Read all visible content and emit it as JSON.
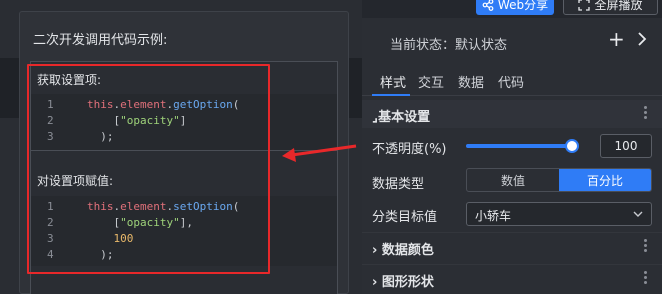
{
  "toolbar": {
    "share_label": "Web分享",
    "fullscreen_label": "全屏播放"
  },
  "panel": {
    "state_label": "当前状态：默认状态",
    "tabs": [
      {
        "label": "样式",
        "active": true
      },
      {
        "label": "交互",
        "active": false
      },
      {
        "label": "数据",
        "active": false
      },
      {
        "label": "代码",
        "active": false
      }
    ],
    "section_basic": "基本设置",
    "opacity": {
      "label": "不透明度(%)",
      "value": "100",
      "fraction": 1.0
    },
    "data_type": {
      "label": "数据类型",
      "options": [
        "数值",
        "百分比"
      ],
      "selected": "百分比"
    },
    "category_target": {
      "label": "分类目标值",
      "value": "小轿车"
    },
    "section_data_color": "数据颜色",
    "section_shape": "图形形状"
  },
  "popup": {
    "title": "二次开发调用代码示例:",
    "get_label": "获取设置项:",
    "set_label": "对设置项赋值:",
    "get_code": [
      {
        "n": "1",
        "parts": [
          [
            "kw",
            "this"
          ],
          [
            "plain",
            "."
          ],
          [
            "kw",
            "element"
          ],
          [
            "plain",
            "."
          ],
          [
            "fn",
            "getOption"
          ],
          [
            "plain",
            "("
          ]
        ]
      },
      {
        "n": "2",
        "parts": [
          [
            "plain",
            "    ["
          ],
          [
            "str",
            "\"opacity\""
          ],
          [
            "plain",
            "]"
          ]
        ]
      },
      {
        "n": "3",
        "parts": [
          [
            "plain",
            "  );"
          ]
        ]
      }
    ],
    "set_code": [
      {
        "n": "1",
        "parts": [
          [
            "kw",
            "this"
          ],
          [
            "plain",
            "."
          ],
          [
            "kw",
            "element"
          ],
          [
            "plain",
            "."
          ],
          [
            "fn",
            "setOption"
          ],
          [
            "plain",
            "("
          ]
        ]
      },
      {
        "n": "2",
        "parts": [
          [
            "plain",
            "    ["
          ],
          [
            "str",
            "\"opacity\""
          ],
          [
            "plain",
            "],"
          ]
        ]
      },
      {
        "n": "3",
        "parts": [
          [
            "num",
            "    100"
          ]
        ]
      },
      {
        "n": "4",
        "parts": [
          [
            "plain",
            "  );"
          ]
        ]
      }
    ]
  },
  "colors": {
    "accent": "#2f7cf6",
    "highlight_frame": "#e8282a"
  }
}
